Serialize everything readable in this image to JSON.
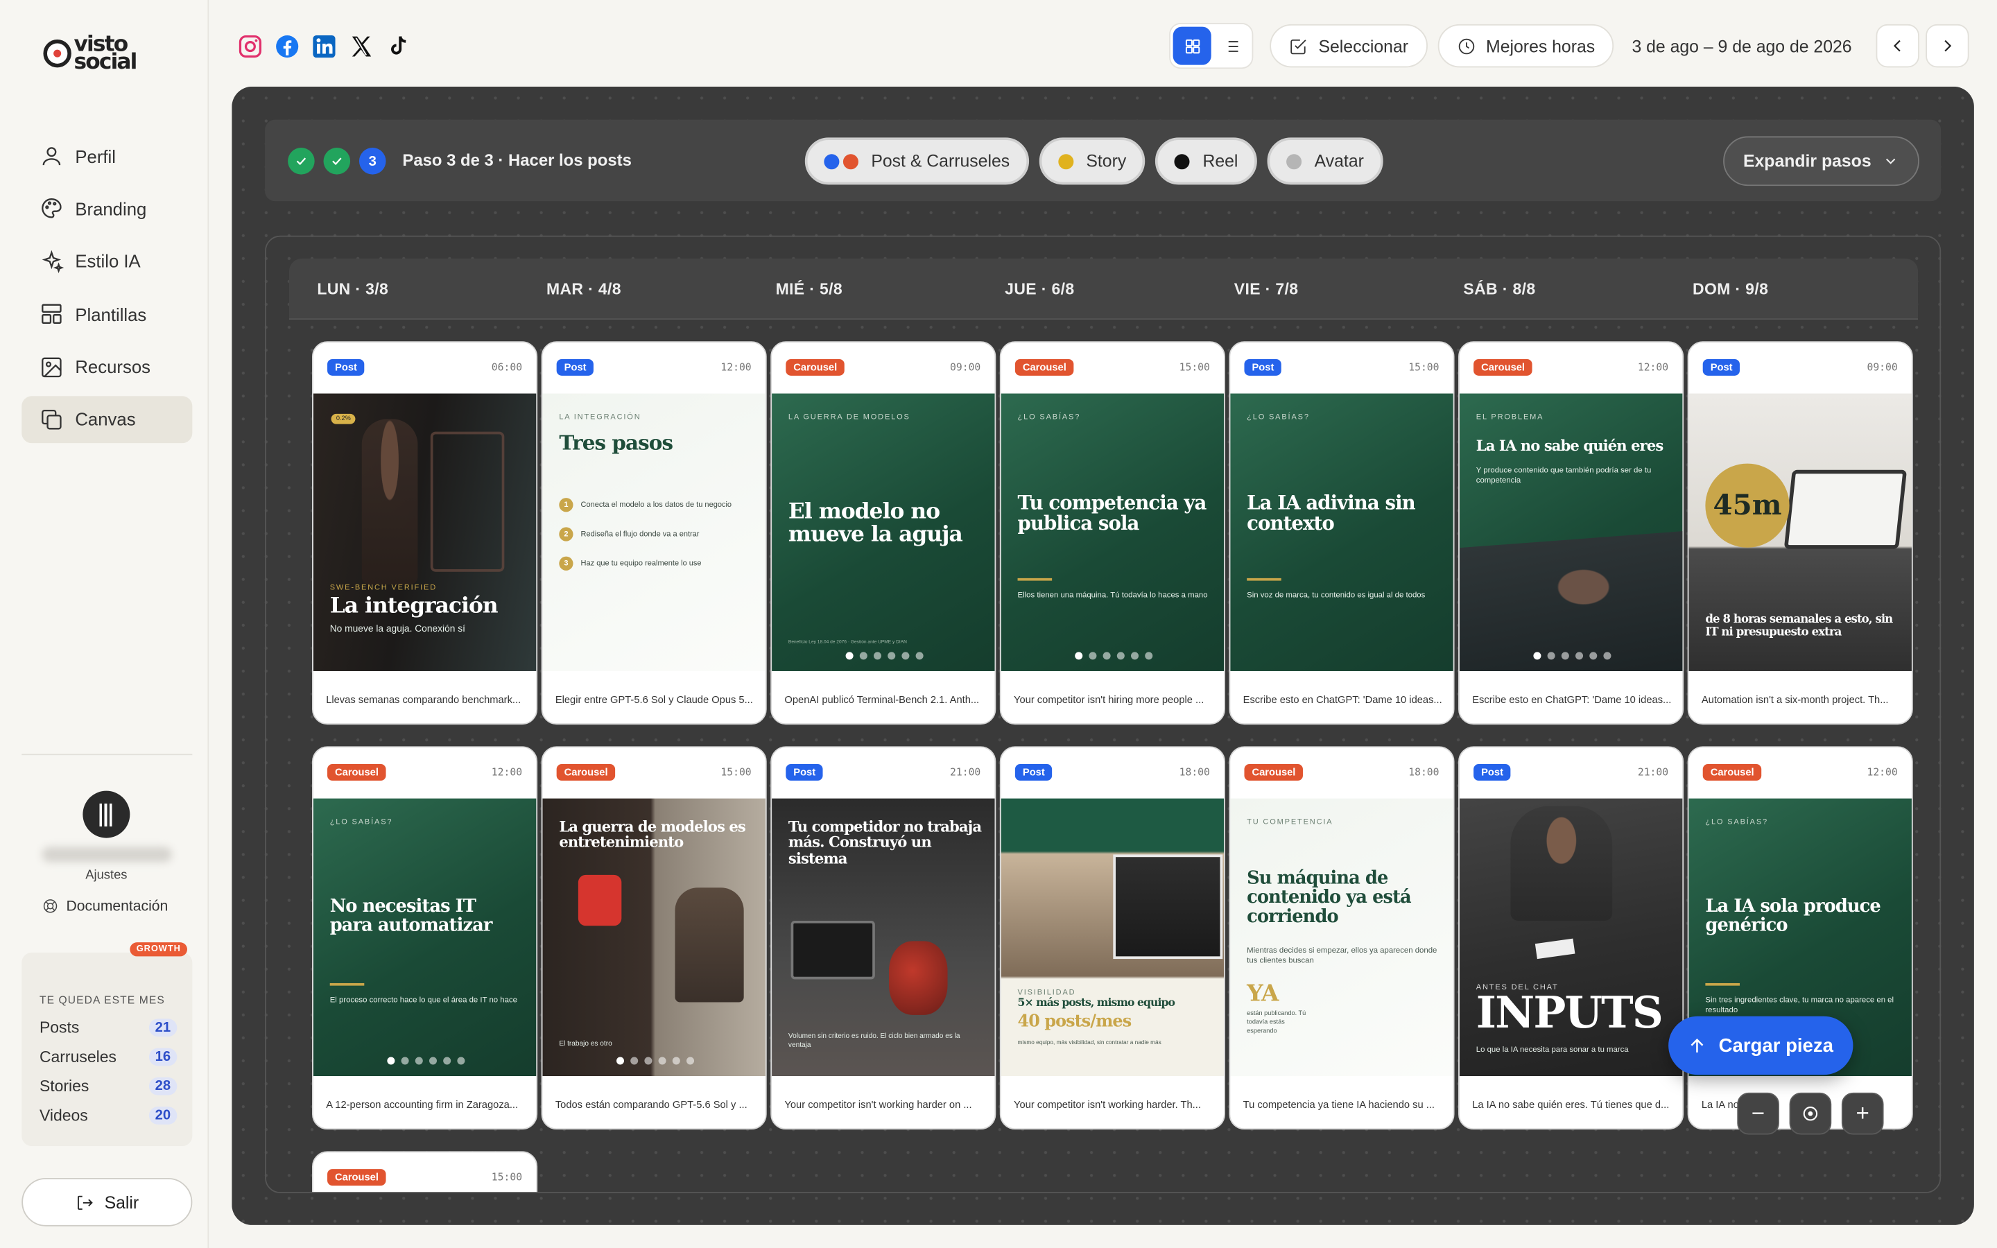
{
  "brand": {
    "logo_text_1": "visto",
    "logo_text_2": "social"
  },
  "sidebar": {
    "items": [
      {
        "label": "Perfil",
        "icon": "user-icon"
      },
      {
        "label": "Branding",
        "icon": "palette-icon"
      },
      {
        "label": "Estilo IA",
        "icon": "sparkles-icon"
      },
      {
        "label": "Plantillas",
        "icon": "layout-icon"
      },
      {
        "label": "Recursos",
        "icon": "image-icon"
      },
      {
        "label": "Canvas",
        "icon": "copy-icon",
        "active": true
      }
    ],
    "settings_label": "Ajustes",
    "docs_label": "Documentación",
    "quota": {
      "badge": "GROWTH",
      "title": "TE QUEDA ESTE MES",
      "rows": [
        {
          "label": "Posts",
          "count": "21"
        },
        {
          "label": "Carruseles",
          "count": "16"
        },
        {
          "label": "Stories",
          "count": "28"
        },
        {
          "label": "Videos",
          "count": "20"
        }
      ]
    },
    "logout_label": "Salir"
  },
  "header": {
    "networks": [
      "instagram-icon",
      "facebook-icon",
      "linkedin-icon",
      "x-icon",
      "tiktok-icon"
    ],
    "select_label": "Seleccionar",
    "best_hours_label": "Mejores horas",
    "date_range": "3 de ago – 9 de ago de 2026"
  },
  "steps": {
    "current_number": "3",
    "label": "Paso 3 de 3 · Hacer los posts",
    "types": [
      {
        "label": "Post & Carruseles",
        "colors": [
          "#2563eb",
          "#e1542f"
        ]
      },
      {
        "label": "Story",
        "colors": [
          "#e0b21f"
        ]
      },
      {
        "label": "Reel",
        "colors": [
          "#111111"
        ]
      },
      {
        "label": "Avatar",
        "colors": [
          "#b5b5b5"
        ]
      }
    ],
    "expand_label": "Expandir pasos"
  },
  "days": [
    "LUN · 3/8",
    "MAR · 4/8",
    "MIÉ · 5/8",
    "JUE · 6/8",
    "VIE · 7/8",
    "SÁB · 8/8",
    "DOM · 9/8"
  ],
  "cards_row1": [
    {
      "tag": "Post",
      "time": "06:00",
      "kicker": "SWE-BENCH VERIFIED",
      "headline": "La integración",
      "sub": "No mueve la aguja. Conexión sí",
      "caption": "Llevas semanas comparando benchmark..."
    },
    {
      "tag": "Post",
      "time": "12:00",
      "kicker": "LA INTEGRACIÓN",
      "headline": "Tres pasos",
      "steps": [
        "Conecta el modelo a los datos de tu negocio",
        "Rediseña el flujo donde va a entrar",
        "Haz que tu equipo realmente lo use"
      ],
      "caption": "Elegir entre GPT-5.6 Sol y Claude Opus 5..."
    },
    {
      "tag": "Carousel",
      "time": "09:00",
      "kicker": "LA GUERRA DE MODELOS",
      "headline": "El modelo no mueve la aguja",
      "sub": "Benefício Ley 18.04 de 2076 · Gestión ante UPME y DIAN",
      "caption": "OpenAI publicó Terminal-Bench 2.1. Anth..."
    },
    {
      "tag": "Carousel",
      "time": "15:00",
      "kicker": "¿LO SABÍAS?",
      "headline": "Tu competencia ya publica sola",
      "sub": "Ellos tienen una máquina. Tú todavía lo haces a mano",
      "caption": "Your competitor isn't hiring more people ..."
    },
    {
      "tag": "Post",
      "time": "15:00",
      "kicker": "¿LO SABÍAS?",
      "headline": "La IA adivina sin contexto",
      "sub": "Sin voz de marca, tu contenido es igual al de todos",
      "caption": "Escribe esto en ChatGPT: 'Dame 10 ideas..."
    },
    {
      "tag": "Carousel",
      "time": "12:00",
      "kicker": "EL PROBLEMA",
      "headline": "La IA no sabe quién eres",
      "sub": "Y produce contenido que también podría ser de tu competencia",
      "caption": "Escribe esto en ChatGPT: 'Dame 10 ideas..."
    },
    {
      "tag": "Post",
      "time": "09:00",
      "badge": "45m",
      "headline": "de 8 horas semanales a esto, sin IT ni presupuesto extra",
      "caption": "Automation isn't a six-month project. Th..."
    }
  ],
  "cards_row2": [
    {
      "tag": "Carousel",
      "time": "12:00",
      "kicker": "¿LO SABÍAS?",
      "headline": "No necesitas IT para automatizar",
      "sub": "El proceso correcto hace lo que el área de IT no hace",
      "caption": "A 12-person accounting firm in Zaragoza..."
    },
    {
      "tag": "Carousel",
      "time": "15:00",
      "headline": "La guerra de modelos es entretenimiento",
      "sub": "El trabajo es otro",
      "caption": "Todos están comparando GPT-5.6 Sol y ..."
    },
    {
      "tag": "Post",
      "time": "21:00",
      "headline": "Tu competidor no trabaja más. Construyó un sistema",
      "sub": "Volumen sin criterio es ruido. El ciclo bien armado es la ventaja",
      "caption": "Your competitor isn't working harder on ..."
    },
    {
      "tag": "Post",
      "time": "18:00",
      "kicker": "VISIBILIDAD",
      "headline": "5× más posts, mismo equipo",
      "headline2": "40 posts/mes",
      "sub": "mismo equipo, más visibilidad, sin contratar a nadie más",
      "caption": "Your competitor isn't working harder. Th..."
    },
    {
      "tag": "Carousel",
      "time": "18:00",
      "kicker": "TU COMPETENCIA",
      "headline": "Su máquina de contenido ya está corriendo",
      "sub": "Mientras decides si empezar, ellos ya aparecen donde tus clientes buscan",
      "big": "YA",
      "sub2": "están publicando. Tú todavía estás esperando",
      "caption": "Tu competencia ya tiene IA haciendo su ..."
    },
    {
      "tag": "Post",
      "time": "21:00",
      "kicker": "ANTES DEL CHAT",
      "headline": "INPUTS",
      "sub": "Lo que la IA necesita para sonar a tu marca",
      "caption": "La IA no sabe quién eres. Tú tienes que d..."
    },
    {
      "tag": "Carousel",
      "time": "12:00",
      "kicker": "¿LO SABÍAS?",
      "headline": "La IA sola produce genérico",
      "sub": "Sin tres ingredientes clave, tu marca no aparece en el resultado",
      "caption": "La IA no..."
    }
  ],
  "card_row3": {
    "tag": "Carousel",
    "time": "15:00"
  },
  "upload_label": "Cargar pieza",
  "zoom": {
    "minus": "−",
    "plus": "+"
  },
  "colors": {
    "accent": "#2563eb",
    "post_tag": "#2563eb",
    "carousel_tag": "#e1542f",
    "canvas": "#3a3a3a",
    "green": "#1e5a43"
  }
}
